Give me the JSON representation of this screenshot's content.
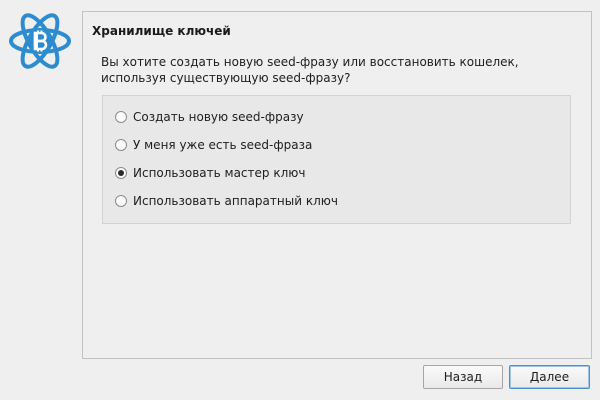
{
  "wizard": {
    "title": "Хранилище ключей",
    "question": "Вы хотите создать новую seed-фразу или восстановить кошелек, используя существующую seed-фразу?",
    "options": [
      {
        "label": "Создать новую seed-фразу",
        "selected": false
      },
      {
        "label": "У меня уже есть seed-фраза",
        "selected": false
      },
      {
        "label": "Использовать мастер ключ",
        "selected": true
      },
      {
        "label": "Использовать аппаратный ключ",
        "selected": false
      }
    ]
  },
  "buttons": {
    "back_label": "Назад",
    "next_label": "Далее"
  },
  "logo": {
    "icon": "electrum-bitcoin-logo-icon",
    "color": "#2d8ccf"
  }
}
